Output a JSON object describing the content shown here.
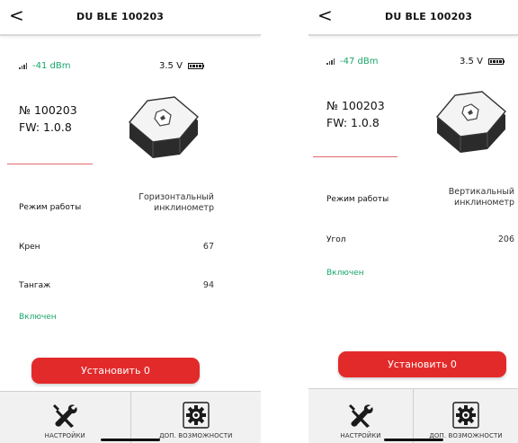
{
  "screens": [
    {
      "title": "DU BLE 100203",
      "back_label": "<",
      "signal": "-41 dBm",
      "voltage": "3.5 V",
      "serial": "№ 100203",
      "firmware": "FW: 1.0.8",
      "mode_label": "Режим работы",
      "mode_value_line1": "Горизонтальный",
      "mode_value_line2": "инклинометр",
      "rows": [
        {
          "label": "Крен",
          "value": "67"
        },
        {
          "label": "Тангаж",
          "value": "94"
        }
      ],
      "status": "Включен",
      "button_label": "Установить 0",
      "tabs": [
        "НАСТРОЙКИ",
        "ДОП. ВОЗМОЖНОСТИ"
      ]
    },
    {
      "title": "DU BLE 100203",
      "back_label": "<",
      "signal": "-47 dBm",
      "voltage": "3.5 V",
      "serial": "№ 100203",
      "firmware": "FW: 1.0.8",
      "mode_label": "Режим работы",
      "mode_value_line1": "Вертикальный",
      "mode_value_line2": "инклинометр",
      "rows": [
        {
          "label": "Угол",
          "value": "206"
        }
      ],
      "status": "Включен",
      "button_label": "Установить 0",
      "tabs": [
        "НАСТРОЙКИ",
        "ДОП. ВОЗМОЖНОСТИ"
      ]
    }
  ],
  "colors": {
    "accent_red": "#e32a2a",
    "status_green": "#1aa66b",
    "divider_pink": "#e06a70"
  },
  "icons": [
    "back-arrow-icon",
    "signal-icon",
    "battery-icon",
    "device-image",
    "wrench-screwdriver-icon",
    "gear-icon"
  ]
}
